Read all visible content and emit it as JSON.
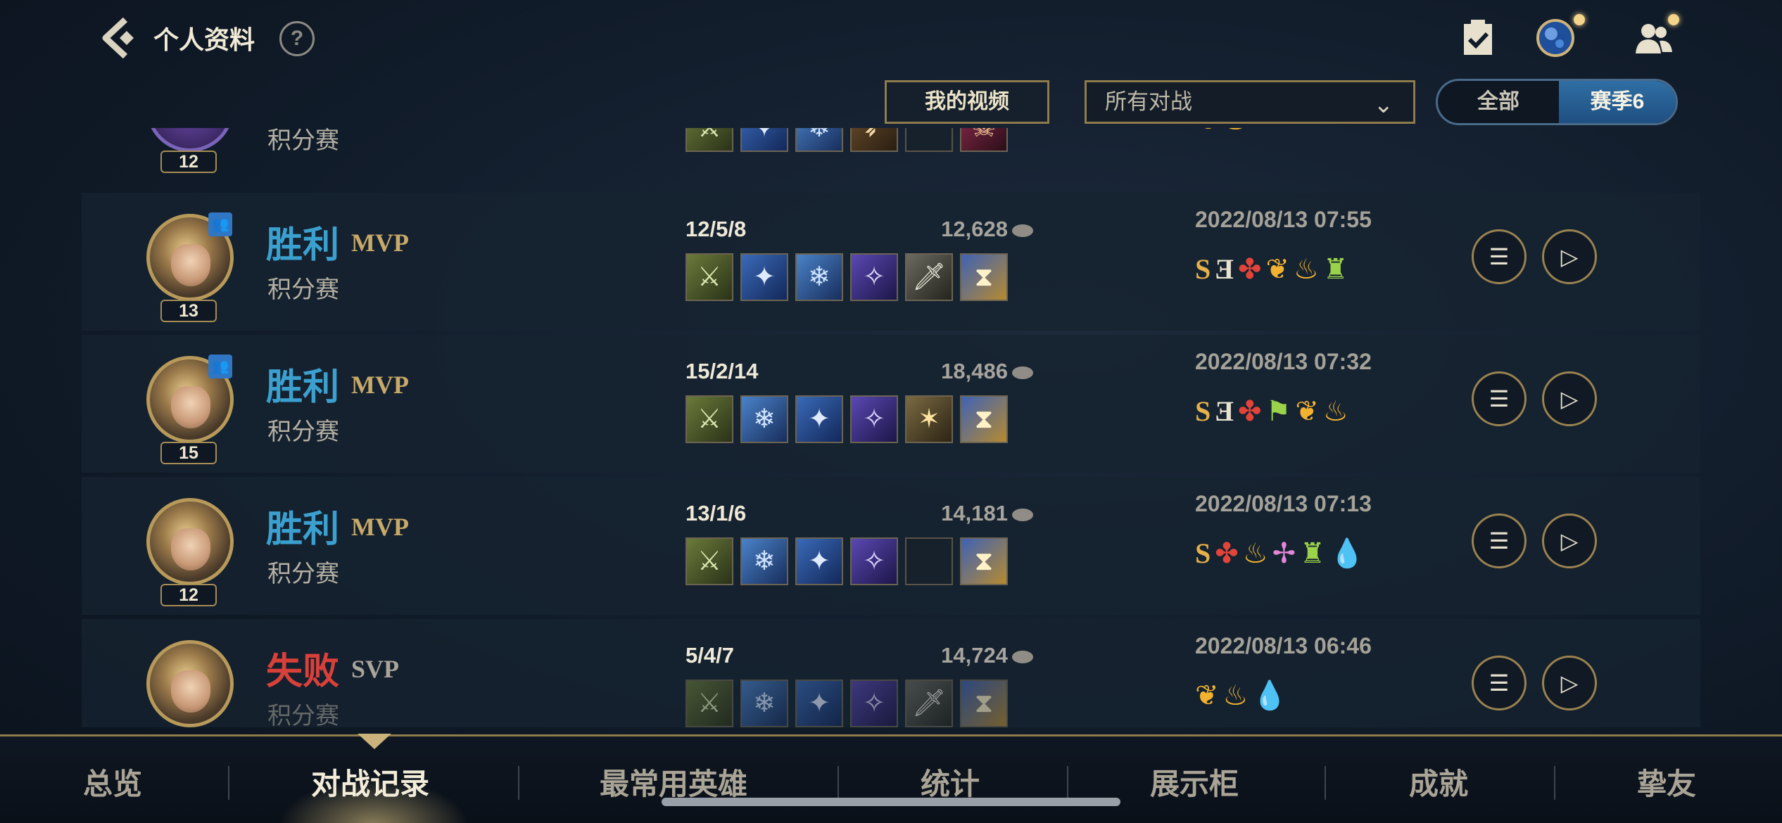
{
  "header": {
    "title": "个人资料",
    "help_symbol": "?",
    "icons": {
      "back": "chevron-left-icon",
      "help": "help-icon",
      "tasks": "clipboard-check-icon",
      "map": "world-orb-icon",
      "friends": "friends-icon"
    }
  },
  "filters": {
    "my_video_label": "我的视频",
    "match_type_selected": "所有对战",
    "scope_all_label": "全部",
    "scope_season_label": "赛季6"
  },
  "partial_top_row": {
    "level": "12",
    "mode": "积分赛"
  },
  "matches": [
    {
      "result": "胜利",
      "result_kind": "win",
      "tag": "MVP",
      "mode": "积分赛",
      "level": "13",
      "kda": "12/5/8",
      "gold": "12,628",
      "date": "2022/08/13 07:55",
      "items": [
        "sword",
        "blade",
        "crystal",
        "void",
        "steel",
        "glass"
      ],
      "honors": [
        "S",
        "Ǝ",
        "wings",
        "laurel",
        "fire",
        "tower"
      ]
    },
    {
      "result": "胜利",
      "result_kind": "win",
      "tag": "MVP",
      "mode": "积分赛",
      "level": "15",
      "kda": "15/2/14",
      "gold": "18,486",
      "date": "2022/08/13 07:32",
      "items": [
        "sword",
        "crystal",
        "blade",
        "void",
        "star",
        "glass"
      ],
      "honors": [
        "S",
        "Ǝ",
        "wings",
        "flag",
        "laurel",
        "fire"
      ]
    },
    {
      "result": "胜利",
      "result_kind": "win",
      "tag": "MVP",
      "mode": "积分赛",
      "level": "12",
      "kda": "13/1/6",
      "gold": "14,181",
      "date": "2022/08/13 07:13",
      "items": [
        "sword",
        "crystal",
        "blade",
        "void",
        "empty",
        "glass"
      ],
      "honors": [
        "S",
        "wings",
        "fire",
        "angel",
        "tower",
        "drop"
      ]
    },
    {
      "result": "失败",
      "result_kind": "lose",
      "tag": "SVP",
      "mode": "积分赛",
      "level": "",
      "kda": "5/4/7",
      "gold": "14,724",
      "date": "2022/08/13 06:46",
      "items": [
        "sword",
        "crystal",
        "blade",
        "void",
        "steel",
        "glass"
      ],
      "honors": [
        "laurel",
        "fire",
        "drop"
      ]
    }
  ],
  "bottom_nav": {
    "tabs": [
      "总览",
      "对战记录",
      "最常用英雄",
      "统计",
      "展示柜",
      "成就",
      "挚友"
    ],
    "active_index": 1
  },
  "colors": {
    "win": "#3ba0cf",
    "lose": "#d8403a",
    "accent_gold": "#8f7b4c",
    "season_active": "#2f6fa4"
  }
}
